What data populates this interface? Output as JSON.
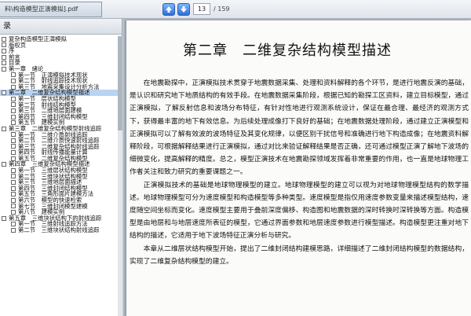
{
  "toolbar": {
    "doc_tab": "料\\构造模型正演模拟].pdf",
    "current_page": "13",
    "total_pages": "/ 159"
  },
  "sidebar": {
    "header": "录",
    "items": [
      {
        "label": "复杂构造模型正演模拟",
        "level": 1
      },
      {
        "label": "版权页",
        "level": 1
      },
      {
        "label": "序",
        "level": 1
      },
      {
        "label": "前言",
        "level": 1
      },
      {
        "label": "目录",
        "level": 1
      },
      {
        "label": "第一章　绪论",
        "level": 1
      },
      {
        "label": "第一节　正演模拟技术现状",
        "level": 2
      },
      {
        "label": "第二节　射线追踪技术现状",
        "level": 2
      },
      {
        "label": "第三节　地震采集设计分析方法",
        "level": 2
      },
      {
        "label": "第二章　二维复杂结构模型描述",
        "level": 1,
        "selected": true
      },
      {
        "label": "第一节　层状结构模型",
        "level": 2
      },
      {
        "label": "第二节　射线结构模型",
        "level": 2
      },
      {
        "label": "第三节　二维地层面建模",
        "level": 2
      },
      {
        "label": "第四节　三维封闭结构模型",
        "level": 2
      },
      {
        "label": "第五节　建模实例",
        "level": 2
      },
      {
        "label": "第三章　二维复杂结构模型射线追踪",
        "level": 1
      },
      {
        "label": "第一节　二维介质射线追踪",
        "level": 2
      },
      {
        "label": "第二节　二维介质快速射线追踪",
        "level": 2
      },
      {
        "label": "第三节　二维复杂结构射线追踪",
        "level": 2
      },
      {
        "label": "第四节　射线传播能量计算",
        "level": 2
      },
      {
        "label": "第五节　二维复杂结构模型",
        "level": 2
      },
      {
        "label": "第四章　三维复杂结构模型描述",
        "level": 1
      },
      {
        "label": "第一节　三维层状结构模型",
        "level": 2
      },
      {
        "label": "第二节　三维块状结构模型",
        "level": 2
      },
      {
        "label": "第三节　三维地层面描述",
        "level": 2
      },
      {
        "label": "第四节　三维封闭结构模型",
        "level": 2
      },
      {
        "label": "第五节　三角形面片建模方法",
        "level": 2
      },
      {
        "label": "第六节　模型的快速检索",
        "level": 2
      },
      {
        "label": "第七节　三维封闭模型建模",
        "level": 2
      },
      {
        "label": "第八节　建模实例",
        "level": 2
      },
      {
        "label": "第五章　三维块状结构下的射线追踪",
        "level": 1
      },
      {
        "label": "第一节　三维射线追踪方法",
        "level": 2
      },
      {
        "label": "第二节　三维块状结构射线追踪",
        "level": 2
      }
    ]
  },
  "document": {
    "chapter_title": "第二章　二维复杂结构模型描述",
    "paragraphs": [
      "在地震勘探中，正演模拟技术贯穿于地震数据采集、处理和资料解释的各个环节，是进行地震反演的基础，是认识和研究地下地质结构的有效手段。在地震数据采集阶段，根据已知的勘探工区资料，建立目标模型，通过正演模拟，了解反射信息和波场分布特征，有针对性地进行观测系统设计，保证在最合理、最经济的观测方式下，获得最丰富的地下有效信息。为后续处理成像打下良好的基础；在地震数据处理阶段，通过建立正演模型和正演模拟可以了解有效波的波场特征及其变化规律，以便区别干扰信号和准确进行地下构造成像；在地震资料解释阶段，可根据解释结果进行正演模拟，通过对比来验证解释结果是否正确，还可通过模型正演了解地下波场的细微变化，提高解释的精度。总之，模型正演技术在地震勘探领域发挥着非常重要的作用，也一直是地球物理工作者关注和致力研究的重要课题之一。",
      "正演模拟技术的基础是地球物理模型的建立。地球物理模型的建立可以视为对地球物理模型结构的数学描述。地球物理模型可分为速度模型和构造模型等多种类型。速度模型是指仅用速度参数变量来描述模型结构，速度随空间坐标而变化。速度模型主要用于叠前深度偏移、构造图和地震数据的深时转换时深转换等方面。构造模型是由地层和与地层速度所表征的模型，它通过界面参数和地层速度参数进行模型描述。构造模型更注重对地下结构的描述，它适用于地下波场特征正演分析与研究。",
      "本章从二维层状结构模型开始，提出了二维封闭结构建模思路，详细描述了二维封闭结构模型的数据结构，实现了二维复杂结构模型的建立。"
    ]
  },
  "colors": {
    "selection": "#b9d3f2",
    "nav_button": "#2f6fd6"
  }
}
